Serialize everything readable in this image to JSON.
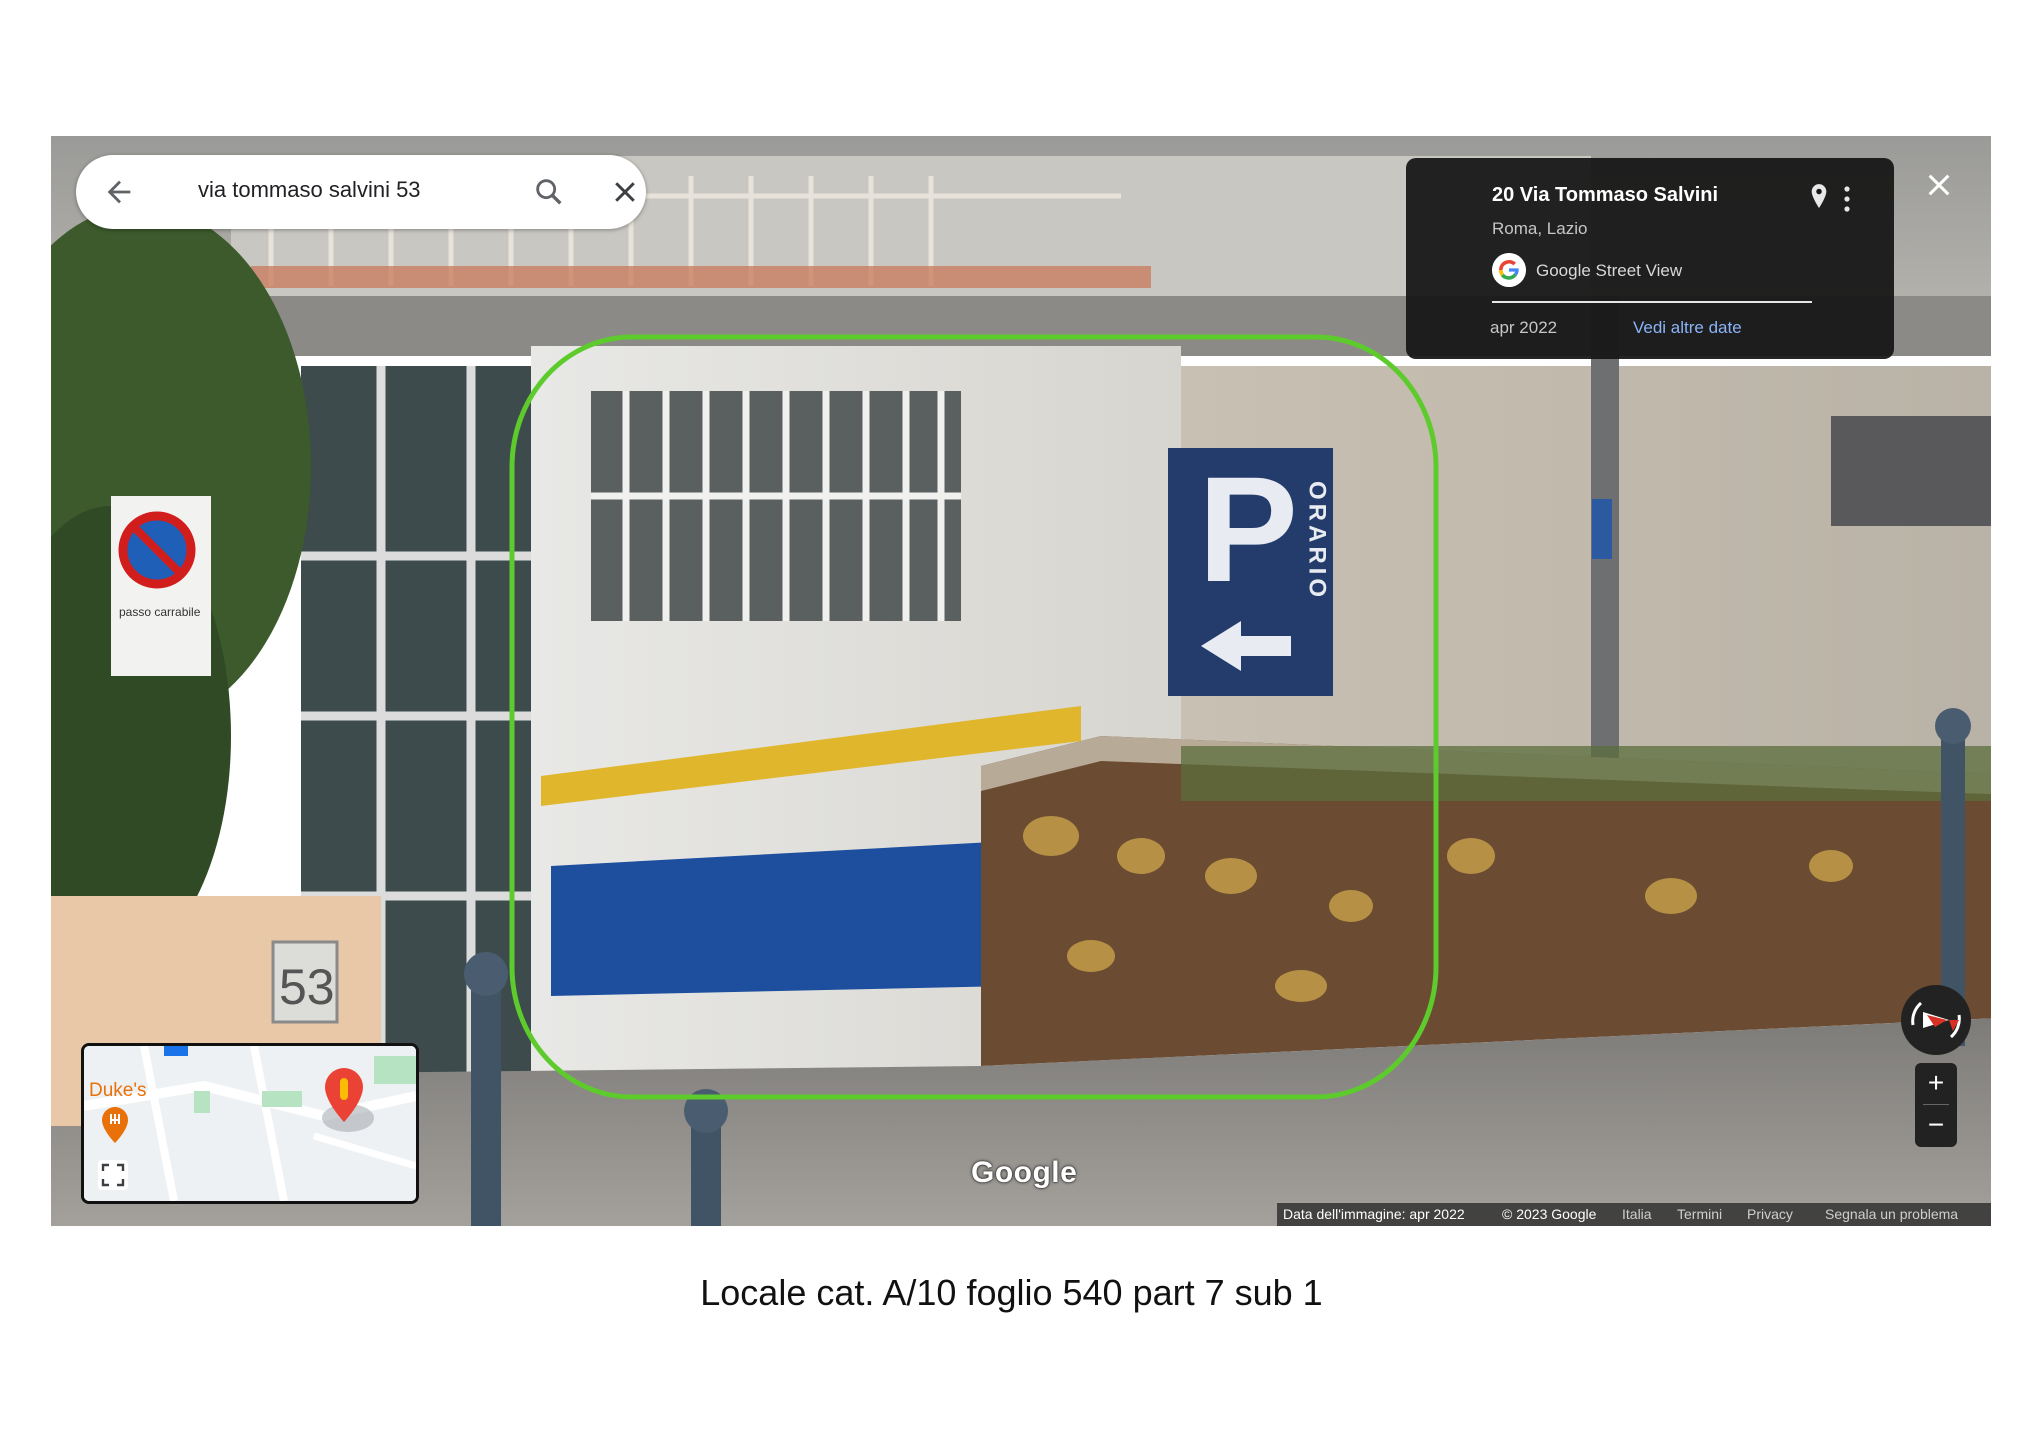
{
  "search": {
    "query": "via tommaso salvini 53"
  },
  "info_card": {
    "title": "20 Via Tommaso Salvini",
    "subtitle": "Roma, Lazio",
    "product": "Google Street View",
    "date": "apr 2022",
    "more_dates": "Vedi altre date"
  },
  "scene": {
    "sign_letter": "P",
    "sign_vertical": "ORARIO",
    "house_number": "53",
    "no_parking_text": "passo carrabile",
    "highlight_color": "#5ecb2c"
  },
  "minimap": {
    "place_label": "Duke's"
  },
  "zoom": {
    "in_label": "+",
    "out_label": "−"
  },
  "watermark": "Google",
  "footer": {
    "image_date": "Data dell'immagine: apr 2022",
    "copyright": "© 2023 Google",
    "italia": "Italia",
    "terms": "Termini",
    "privacy": "Privacy",
    "report": "Segnala un problema"
  },
  "caption": "Locale cat. A/10 foglio 540 part 7 sub 1",
  "icons": [
    "back-arrow-icon",
    "search-icon",
    "close-icon",
    "place-pin-icon",
    "more-vert-icon",
    "google-logo-icon",
    "fullscreen-icon",
    "compass-icon",
    "map-pin-icon"
  ]
}
